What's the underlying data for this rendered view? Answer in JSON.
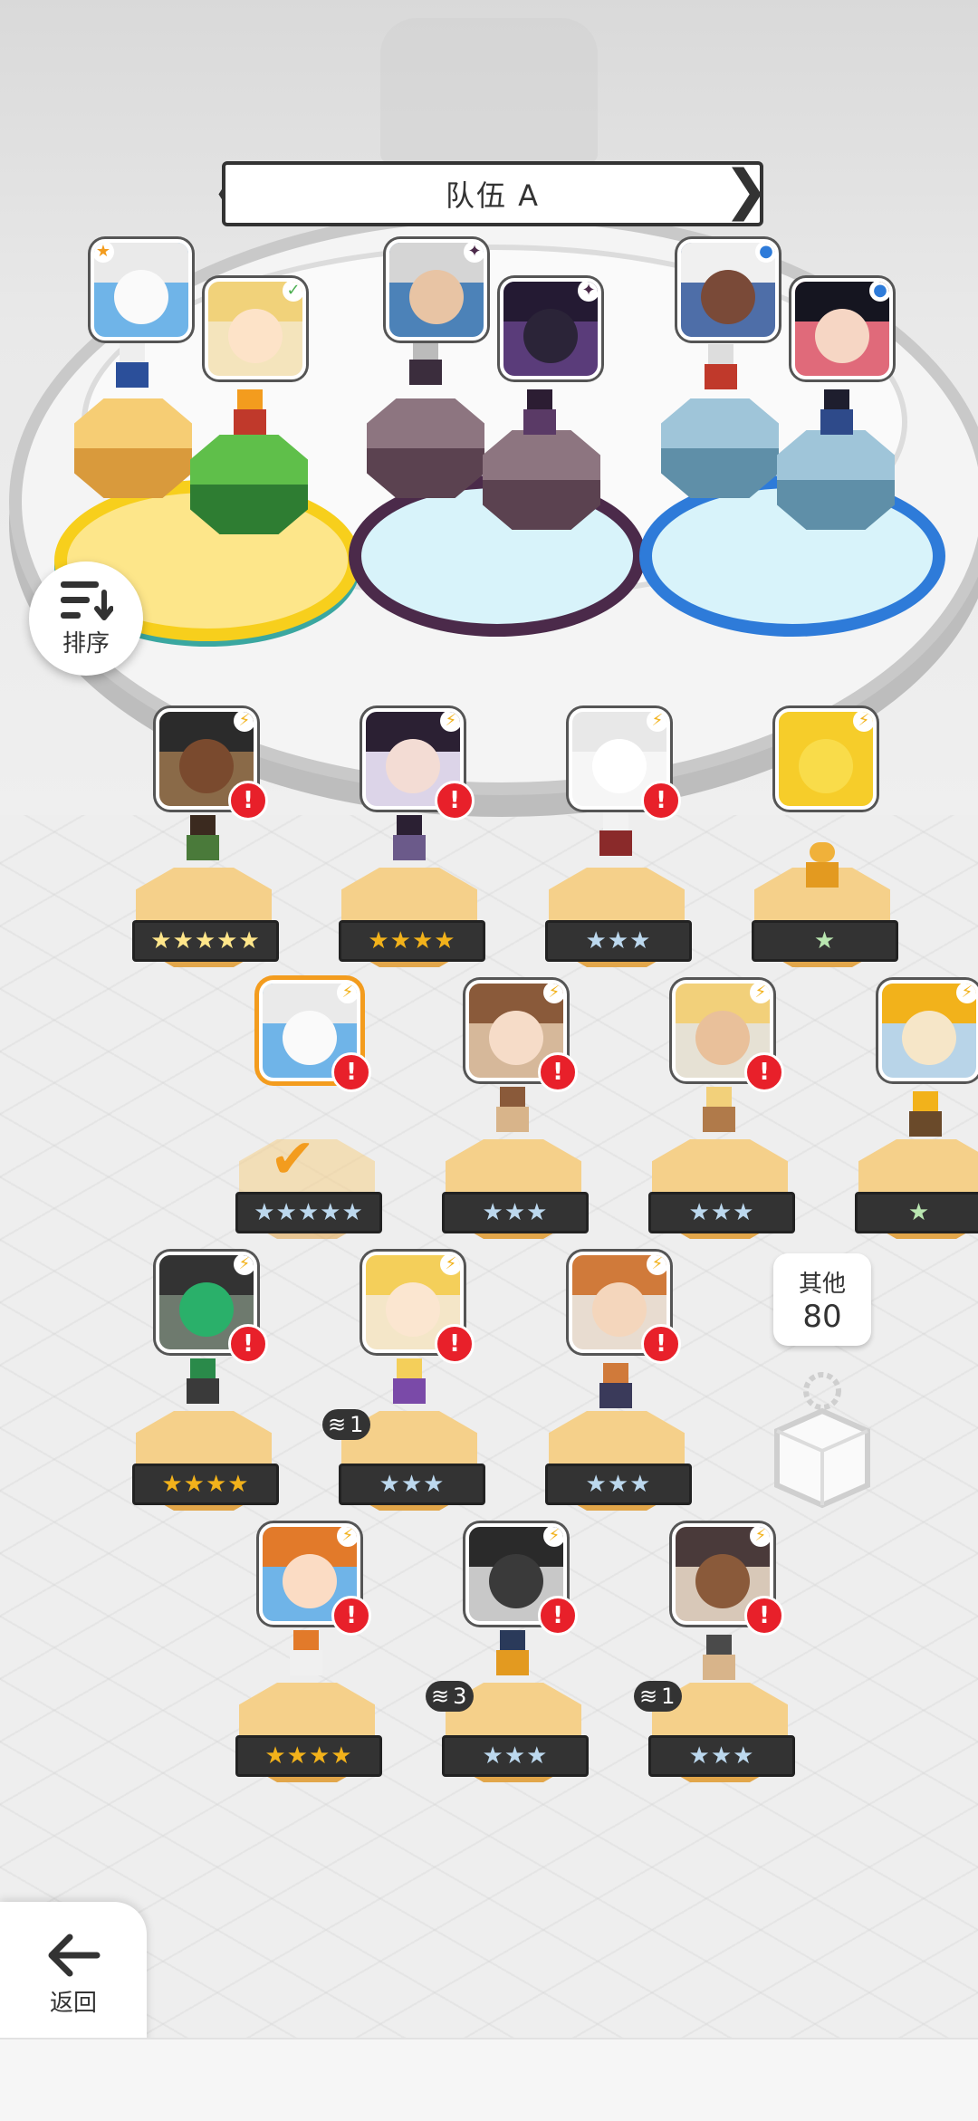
{
  "team": {
    "title": "队伍 A",
    "prev_arrow": "❮",
    "next_arrow": "❯"
  },
  "sort": {
    "label": "排序",
    "icon": "sort-icon"
  },
  "back": {
    "label": "返回",
    "icon": "back-arrow-icon"
  },
  "others": {
    "label": "其他",
    "count": "80"
  },
  "team_slots": [
    {
      "group": "yellow",
      "badge": "★",
      "badge_color": "#f39c1e"
    },
    {
      "group": "yellow",
      "badge": "✓",
      "badge_color": "#4caf50"
    },
    {
      "group": "purple",
      "badge": "✦",
      "badge_color": "#4b2a4a"
    },
    {
      "group": "purple",
      "badge": "✦",
      "badge_color": "#4b2a4a"
    },
    {
      "group": "blue",
      "badge": "●",
      "badge_color": "#2e7bd9"
    },
    {
      "group": "blue",
      "badge": "●",
      "badge_color": "#2e7bd9"
    }
  ],
  "roster": [
    {
      "stars": "★★★★★",
      "tier": "rainbow",
      "alert": "!",
      "stack": ""
    },
    {
      "stars": "★★★★",
      "tier": "gold",
      "alert": "!",
      "stack": ""
    },
    {
      "stars": "★★★",
      "tier": "blue",
      "alert": "!",
      "stack": ""
    },
    {
      "stars": "★",
      "tier": "green",
      "alert": "",
      "stack": ""
    },
    {
      "stars": "★★★★★",
      "tier": "blue",
      "alert": "!",
      "stack": "",
      "selected": true
    },
    {
      "stars": "★★★",
      "tier": "blue",
      "alert": "!",
      "stack": ""
    },
    {
      "stars": "★★★",
      "tier": "blue",
      "alert": "!",
      "stack": ""
    },
    {
      "stars": "★",
      "tier": "green",
      "alert": "",
      "stack": ""
    },
    {
      "stars": "★★★★",
      "tier": "gold",
      "alert": "!",
      "stack": ""
    },
    {
      "stars": "★★★",
      "tier": "blue",
      "alert": "!",
      "stack": "1"
    },
    {
      "stars": "★★★",
      "tier": "blue",
      "alert": "!",
      "stack": ""
    },
    {
      "stars": "★★★★",
      "tier": "gold",
      "alert": "!",
      "stack": ""
    },
    {
      "stars": "★★★",
      "tier": "blue",
      "alert": "!",
      "stack": "3"
    },
    {
      "stars": "★★★",
      "tier": "blue",
      "alert": "!",
      "stack": "1"
    }
  ],
  "colors": {
    "alert": "#e8202a",
    "selected": "#f39c1e",
    "yellow_ring": "#f7cf1c",
    "purple_ring": "#4b2a4a",
    "blue_ring": "#2e7bd9"
  }
}
